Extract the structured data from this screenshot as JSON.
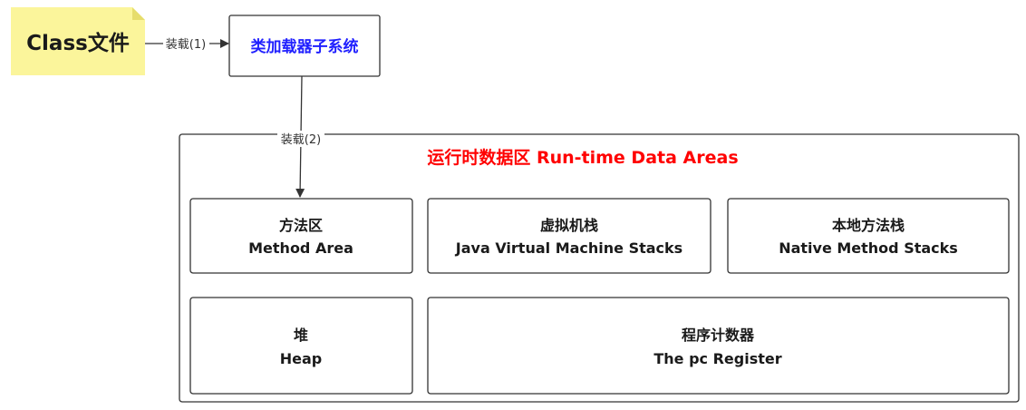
{
  "note": {
    "label": "Class文件",
    "color": "#fbf59b"
  },
  "loader": {
    "label": "类加载器子系统",
    "color": "#2020ff"
  },
  "edges": {
    "load1": "装载(1)",
    "load2": "装载(2)"
  },
  "runtime": {
    "title": "运行时数据区 Run-time Data Areas",
    "title_color": "#ff0000",
    "areas": {
      "method_area": {
        "zh": "方法区",
        "en": "Method Area"
      },
      "vm_stacks": {
        "zh": "虚拟机栈",
        "en": "Java Virtual Machine Stacks"
      },
      "native_stacks": {
        "zh": "本地方法栈",
        "en": "Native Method Stacks"
      },
      "heap": {
        "zh": "堆",
        "en": "Heap"
      },
      "pc_register": {
        "zh": "程序计数器",
        "en": "The pc Register"
      }
    }
  },
  "icons": {
    "arrow": "arrow-head-icon",
    "note_fold": "note-fold-icon"
  }
}
